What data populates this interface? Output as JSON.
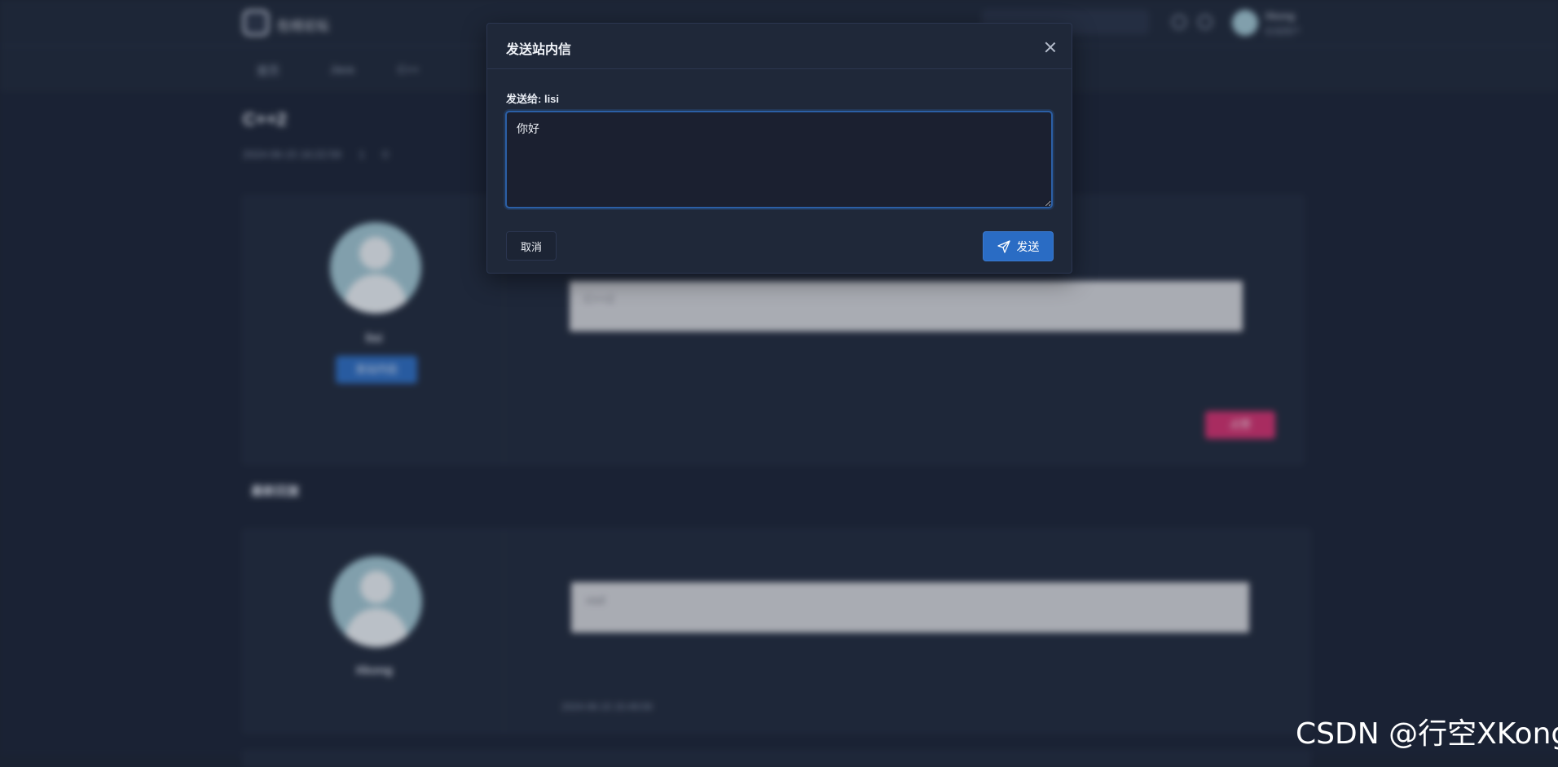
{
  "background": {
    "site_name": "在线论坛",
    "search_placeholder": "",
    "user": {
      "name": "Xkong",
      "sub": "在线用户"
    },
    "breadcrumbs": [
      "首页",
      "Java",
      "C++"
    ],
    "post_title": "C++2",
    "post_meta": {
      "time": "2024-06-15 16:22:59",
      "views": "1",
      "likes": "0"
    },
    "author": "lisi",
    "message_button_label": "发站内信",
    "post_content": "C++2",
    "like_button_label": "点赞",
    "replies_title": "最新回复",
    "reply": {
      "author": "Xkong",
      "content": "xsd",
      "time": "2024-06-15 15:49:59"
    }
  },
  "modal": {
    "title": "发送站内信",
    "recipient_label": "发送给: ",
    "recipient_name": "lisi",
    "message_value": "你好",
    "cancel_label": "取消",
    "send_label": "发送",
    "colors": {
      "primary": "#2a6cc4",
      "focus_border": "#2b5fa6"
    }
  },
  "watermark": "CSDN @行空XKong"
}
